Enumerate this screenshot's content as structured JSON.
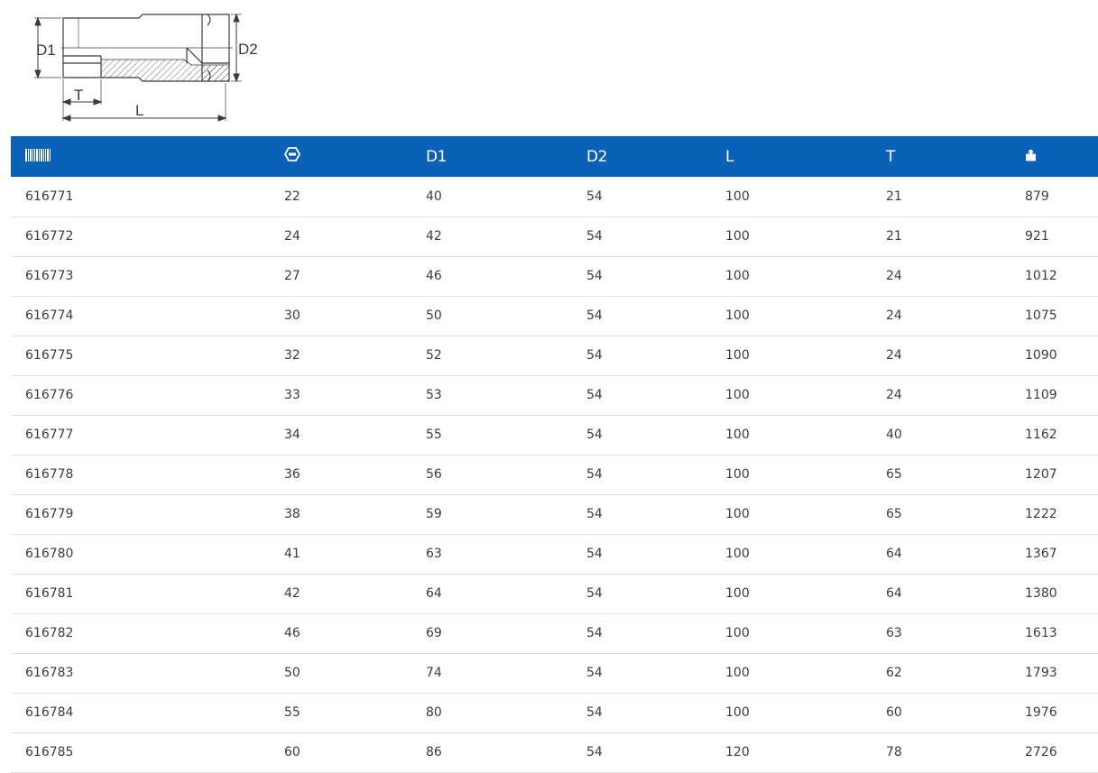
{
  "diagram": {
    "labels": {
      "d1": "D1",
      "d2": "D2",
      "t": "T",
      "l": "L"
    }
  },
  "table": {
    "headers": {
      "article_icon": "barcode-icon",
      "size_icon": "hex-wrench-size-icon",
      "d1": "D1",
      "d2": "D2",
      "l": "L",
      "t": "T",
      "weight_icon": "weight-icon"
    },
    "rows": [
      [
        "616771",
        "22",
        "40",
        "54",
        "100",
        "21",
        "879"
      ],
      [
        "616772",
        "24",
        "42",
        "54",
        "100",
        "21",
        "921"
      ],
      [
        "616773",
        "27",
        "46",
        "54",
        "100",
        "24",
        "1012"
      ],
      [
        "616774",
        "30",
        "50",
        "54",
        "100",
        "24",
        "1075"
      ],
      [
        "616775",
        "32",
        "52",
        "54",
        "100",
        "24",
        "1090"
      ],
      [
        "616776",
        "33",
        "53",
        "54",
        "100",
        "24",
        "1109"
      ],
      [
        "616777",
        "34",
        "55",
        "54",
        "100",
        "40",
        "1162"
      ],
      [
        "616778",
        "36",
        "56",
        "54",
        "100",
        "65",
        "1207"
      ],
      [
        "616779",
        "38",
        "59",
        "54",
        "100",
        "65",
        "1222"
      ],
      [
        "616780",
        "41",
        "63",
        "54",
        "100",
        "64",
        "1367"
      ],
      [
        "616781",
        "42",
        "64",
        "54",
        "100",
        "64",
        "1380"
      ],
      [
        "616782",
        "46",
        "69",
        "54",
        "100",
        "63",
        "1613"
      ],
      [
        "616783",
        "50",
        "74",
        "54",
        "100",
        "62",
        "1793"
      ],
      [
        "616784",
        "55",
        "80",
        "54",
        "100",
        "60",
        "1976"
      ],
      [
        "616785",
        "60",
        "86",
        "54",
        "120",
        "78",
        "2726"
      ]
    ]
  },
  "colors": {
    "header_bg": "#0a62b8",
    "header_text": "#ffffff",
    "row_border": "#e2e2e2",
    "drawing_line": "#3a3a3a",
    "drawing_fill": "#ffffff",
    "drawing_shade": "#eeeeee"
  }
}
